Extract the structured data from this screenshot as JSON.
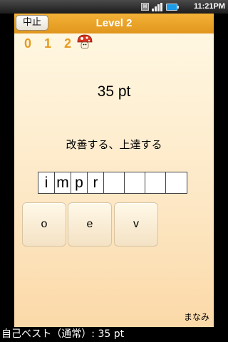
{
  "status_bar": {
    "time": "11:21PM",
    "hint_icon": "h-icon",
    "battery_color": "#1e9be8"
  },
  "header": {
    "stop_label": "中止",
    "title": "Level 2",
    "bar_color": "#e9a12a"
  },
  "progress": {
    "labels": [
      "0",
      "1",
      "2"
    ],
    "color": "#e69a20",
    "marker_icon": "mushroom-icon"
  },
  "game": {
    "score": "35 pt",
    "prompt": "改善する、上達する",
    "answer_letters": [
      "i",
      "m",
      "p",
      "r",
      "",
      "",
      "",
      ""
    ],
    "choices": [
      "o",
      "e",
      "v"
    ]
  },
  "footer": {
    "user_name": "まなみ",
    "best_score": "自己ベスト（通常）: 35 pt"
  }
}
